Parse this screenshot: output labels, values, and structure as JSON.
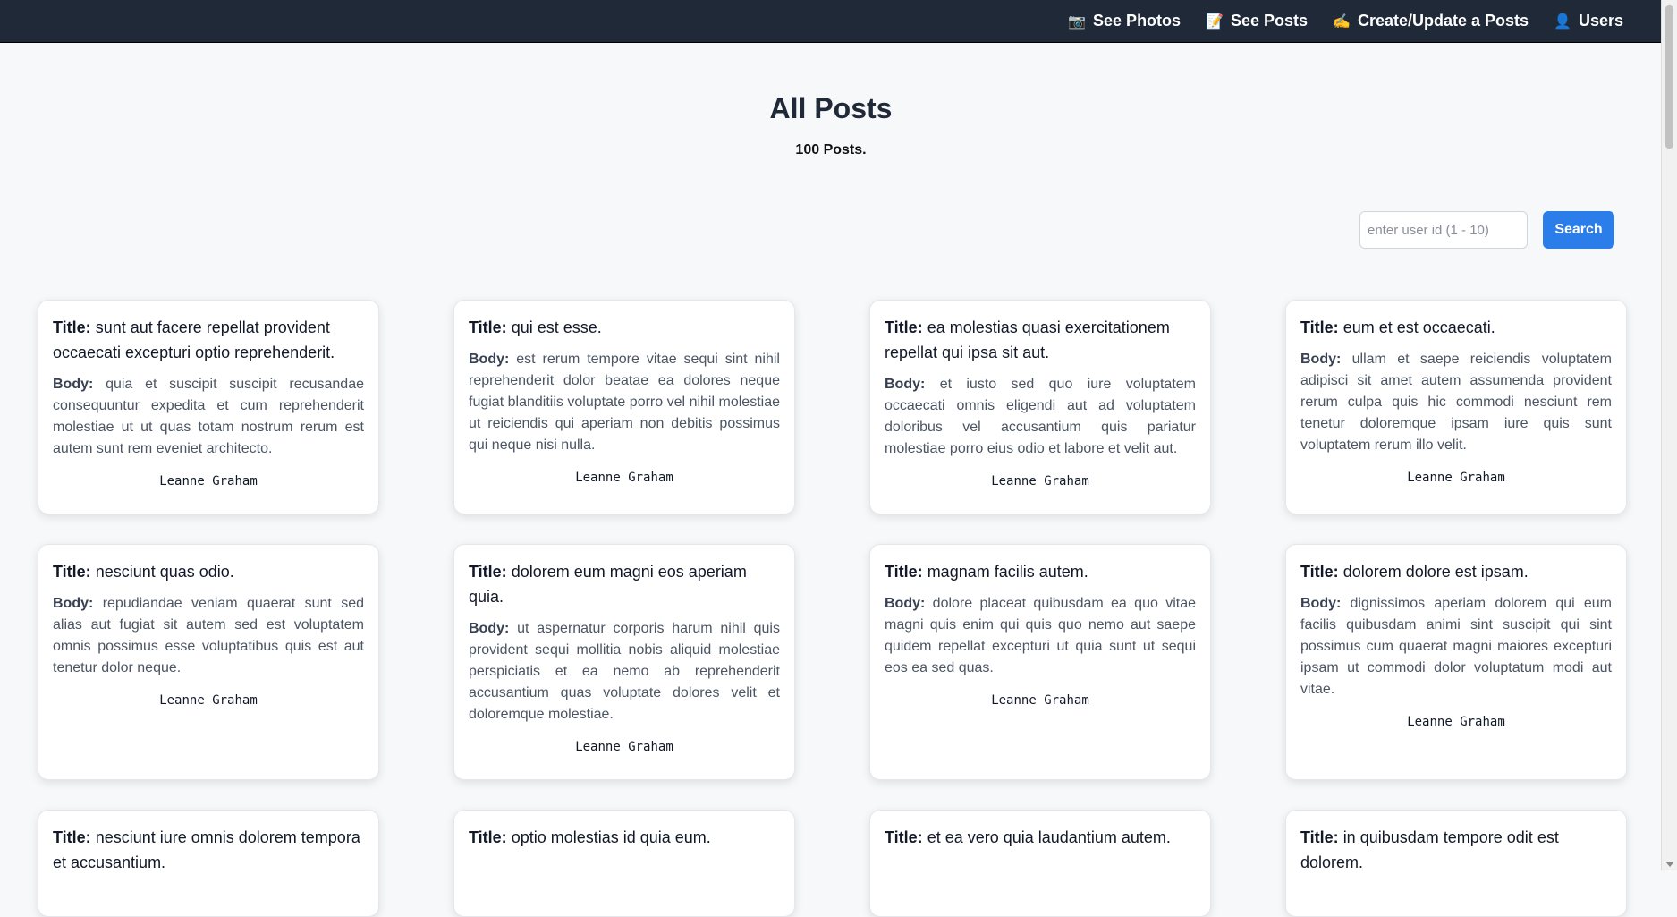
{
  "nav": {
    "items": [
      {
        "icon": "camera-icon",
        "glyph": "📷",
        "label": "See Photos"
      },
      {
        "icon": "memo-icon",
        "glyph": "📝",
        "label": "See Posts"
      },
      {
        "icon": "writing-hand-icon",
        "glyph": "✍️",
        "label": "Create/Update a Posts"
      },
      {
        "icon": "user-icon",
        "glyph": "👤",
        "label": "Users"
      }
    ]
  },
  "header": {
    "title": "All Posts",
    "count": "100 Posts."
  },
  "search": {
    "placeholder": "enter user id (1 - 10)",
    "button_label": "Search"
  },
  "labels": {
    "title": "Title:",
    "body": "Body:"
  },
  "posts": [
    {
      "title": "sunt aut facere repellat provident occaecati excepturi optio reprehenderit.",
      "body": "quia et suscipit suscipit recusandae consequuntur expedita et cum reprehenderit molestiae ut ut quas totam nostrum rerum est autem sunt rem eveniet architecto.",
      "author": "Leanne Graham"
    },
    {
      "title": "qui est esse.",
      "body": "est rerum tempore vitae sequi sint nihil reprehenderit dolor beatae ea dolores neque fugiat blanditiis voluptate porro vel nihil molestiae ut reiciendis qui aperiam non debitis possimus qui neque nisi nulla.",
      "author": "Leanne Graham"
    },
    {
      "title": "ea molestias quasi exercitationem repellat qui ipsa sit aut.",
      "body": "et iusto sed quo iure voluptatem occaecati omnis eligendi aut ad voluptatem doloribus vel accusantium quis pariatur molestiae porro eius odio et labore et velit aut.",
      "author": "Leanne Graham"
    },
    {
      "title": "eum et est occaecati.",
      "body": "ullam et saepe reiciendis voluptatem adipisci sit amet autem assumenda provident rerum culpa quis hic commodi nesciunt rem tenetur doloremque ipsam iure quis sunt voluptatem rerum illo velit.",
      "author": "Leanne Graham"
    },
    {
      "title": "nesciunt quas odio.",
      "body": "repudiandae veniam quaerat sunt sed alias aut fugiat sit autem sed est voluptatem omnis possimus esse voluptatibus quis est aut tenetur dolor neque.",
      "author": "Leanne Graham"
    },
    {
      "title": "dolorem eum magni eos aperiam quia.",
      "body": "ut aspernatur corporis harum nihil quis provident sequi mollitia nobis aliquid molestiae perspiciatis et ea nemo ab reprehenderit accusantium quas voluptate dolores velit et doloremque molestiae.",
      "author": "Leanne Graham"
    },
    {
      "title": "magnam facilis autem.",
      "body": "dolore placeat quibusdam ea quo vitae magni quis enim qui quis quo nemo aut saepe quidem repellat excepturi ut quia sunt ut sequi eos ea sed quas.",
      "author": "Leanne Graham"
    },
    {
      "title": "dolorem dolore est ipsam.",
      "body": "dignissimos aperiam dolorem qui eum facilis quibusdam animi sint suscipit qui sint possimus cum quaerat magni maiores excepturi ipsam ut commodi dolor voluptatum modi aut vitae.",
      "author": "Leanne Graham"
    },
    {
      "title": "nesciunt iure omnis dolorem tempora et accusantium."
    },
    {
      "title": "optio molestias id quia eum."
    },
    {
      "title": "et ea vero quia laudantium autem."
    },
    {
      "title": "in quibusdam tempore odit est dolorem."
    }
  ]
}
